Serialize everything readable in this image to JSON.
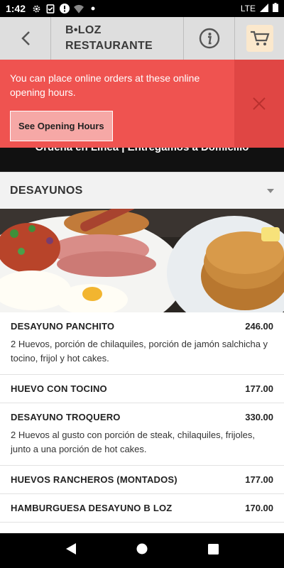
{
  "status_bar": {
    "time": "1:42",
    "network": "LTE"
  },
  "header": {
    "title_line1": "B•LOZ",
    "title_line2": "RESTAURANTE",
    "back_icon": "arrow-back-icon",
    "info_icon": "info-icon",
    "cart_icon": "cart-icon"
  },
  "notice": {
    "text": "You can place online orders at these online opening hours.",
    "button_label": "See Opening Hours",
    "close_icon": "close-icon",
    "color": "#ef5350"
  },
  "banner": {
    "text": "Ordena en Línea | Entregamos a Domicilio"
  },
  "category": {
    "title": "DESAYUNOS"
  },
  "menu": {
    "items": [
      {
        "name": "DESAYUNO PANCHITO",
        "price": "246.00",
        "description": "2 Huevos, porción de chilaquiles, porción de jamón salchicha y tocino, frijol y hot cakes."
      },
      {
        "name": "HUEVO CON TOCINO",
        "price": "177.00",
        "description": ""
      },
      {
        "name": "DESAYUNO TROQUERO",
        "price": "330.00",
        "description": "2 Huevos al gusto con porción de steak, chilaquiles, frijoles, junto a una porción de hot cakes."
      },
      {
        "name": "HUEVOS RANCHEROS (MONTADOS)",
        "price": "177.00",
        "description": ""
      },
      {
        "name": "HAMBURGUESA DESAYUNO B LOZ",
        "price": "170.00",
        "description": ""
      }
    ]
  }
}
